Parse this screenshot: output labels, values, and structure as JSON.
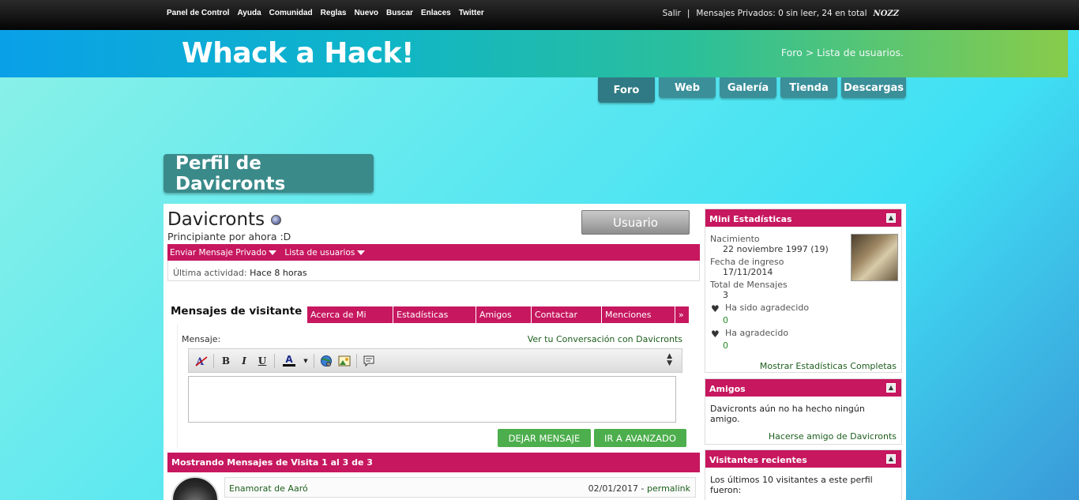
{
  "topbar": {
    "nav": [
      "Panel de Control",
      "Ayuda",
      "Comunidad",
      "Reglas",
      "Nuevo",
      "Buscar",
      "Enlaces",
      "Twitter"
    ],
    "logout": "Salir",
    "separator": "|",
    "pm_status": "Mensajes Privados: 0 sin leer, 24 en total",
    "brand": "NOZZ"
  },
  "header": {
    "site_title": "Whack a Hack!",
    "breadcrumb": "Foro > Lista de usuarios."
  },
  "main_tabs": [
    "Foro",
    "Web",
    "Galería",
    "Tienda",
    "Descargas"
  ],
  "profile": {
    "page_title": "Perfil de Davicronts",
    "username": "Davicronts",
    "user_title": "Principiante por ahora :D",
    "rank_button": "Usuario",
    "actions": [
      "Enviar Mensaje Privado",
      "Lista de usuarios"
    ],
    "last_activity_label": "Última actividad:",
    "last_activity_value": "Hace 8 horas"
  },
  "section_tabs": {
    "active": "Mensajes de visitante",
    "others": [
      "Acerca de Mi",
      "Estadísticas",
      "Amigos",
      "Contactar",
      "Menciones",
      "»"
    ]
  },
  "message_form": {
    "label": "Mensaje:",
    "conversation_link": "Ver tu Conversación con Davicronts",
    "toolbar": {
      "bold": "B",
      "italic": "I",
      "underline": "U",
      "color": "A"
    },
    "submit_label": "DEJAR MENSAJE",
    "advanced_label": "IR A AVANZADO"
  },
  "messages": {
    "header": "Mostrando Mensajes de Visita 1 al 3 de 3",
    "items": [
      {
        "author": "Enamorat de Aaró",
        "date": "02/01/2017",
        "separator": "-",
        "permalink": "permalink"
      }
    ]
  },
  "sidebar": {
    "mini_stats": {
      "title": "Mini Estadísticas",
      "birth_label": "Nacimiento",
      "birth_value": "22 noviembre 1997 (19)",
      "join_label": "Fecha de ingreso",
      "join_value": "17/11/2014",
      "posts_label": "Total de Mensajes",
      "posts_value": "3",
      "thanked_label": "Ha sido agradecido",
      "thanked_value": "0",
      "gave_thanks_label": "Ha agradecido",
      "gave_thanks_value": "0",
      "more_link": "Mostrar Estadísticas Completas"
    },
    "friends": {
      "title": "Amigos",
      "text": "Davicronts aún no ha hecho ningún amigo.",
      "link": "Hacerse amigo de Davicronts"
    },
    "visitors": {
      "title": "Visitantes recientes",
      "text": "Los últimos 10 visitantes a este perfil fueron:"
    }
  }
}
